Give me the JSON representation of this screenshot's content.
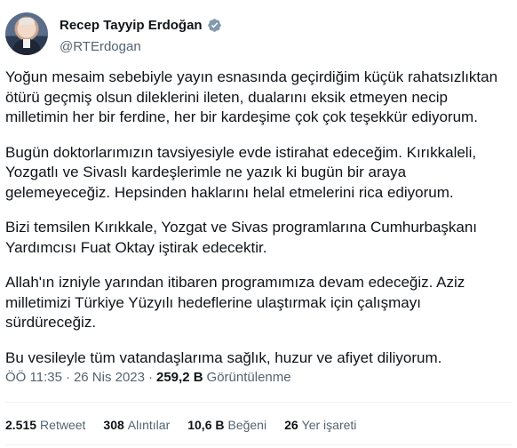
{
  "author": {
    "name": "Recep Tayyip Erdoğan",
    "handle": "@RTErdogan"
  },
  "tweet": {
    "paragraphs": [
      "Yoğun mesaim sebebiyle yayın esnasında geçirdiğim küçük rahatsızlıktan\nötürü geçmiş olsun dileklerini ileten, dualarını eksik etmeyen necip\nmilletimin her bir ferdine, her bir kardeşime çok çok teşekkür ediyorum.",
      "Bugün doktorlarımızın tavsiyesiyle evde istirahat edeceğim. Kırıkkaleli,\nYozgatlı ve Sivaslı kardeşlerimle ne yazık ki bugün bir araya\ngelemeyeceğiz. Hepsinden haklarını helal etmelerini rica ediyorum.",
      "Bizi temsilen Kırıkkale, Yozgat ve Sivas programlarına Cumhurbaşkanı\nYardımcısı Fuat Oktay iştirak edecektir.",
      "Allah'ın izniyle yarından itibaren programımıza devam edeceğiz. Aziz\nmilletimizi Türkiye Yüzyılı hedeflerine ulaştırmak için çalışmayı\nsürdüreceğiz.",
      "Bu vesileyle tüm vatandaşlarıma sağlık, huzur ve afiyet diliyorum."
    ]
  },
  "meta": {
    "time": "ÖÖ 11:35",
    "separator": "·",
    "date": "26 Nis 2023",
    "views_count": "259,2 B",
    "views_label": "Görüntülenme"
  },
  "stats": {
    "retweets_count": "2.515",
    "retweets_label": "Retweet",
    "quotes_count": "308",
    "quotes_label": "Alıntılar",
    "likes_count": "10,6 B",
    "likes_label": "Beğeni",
    "bookmarks_count": "26",
    "bookmarks_label": "Yer işareti"
  },
  "colors": {
    "verified": "#829aab",
    "muted": "#536471",
    "text": "#0f1419"
  },
  "icons": {
    "verified": "verified-badge-icon"
  }
}
